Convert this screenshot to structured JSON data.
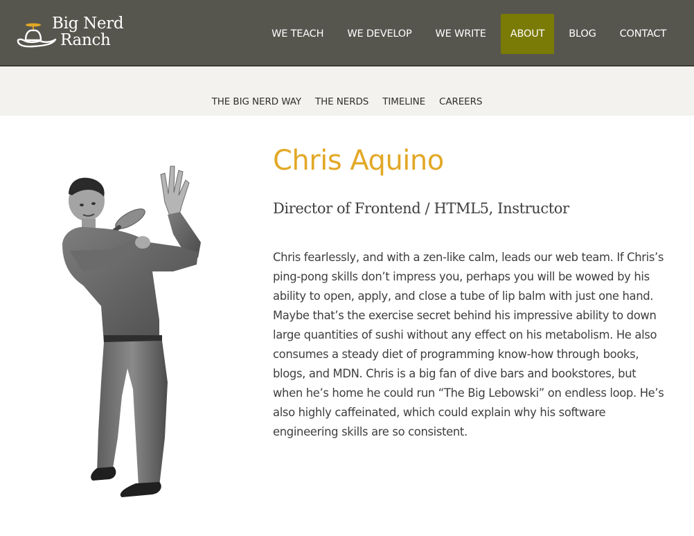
{
  "brand": {
    "line1": "Big Nerd",
    "line2": "Ranch"
  },
  "nav": {
    "items": [
      {
        "label": "WE TEACH"
      },
      {
        "label": "WE DEVELOP"
      },
      {
        "label": "WE WRITE"
      },
      {
        "label": "ABOUT",
        "active": true
      },
      {
        "label": "BLOG"
      },
      {
        "label": "CONTACT"
      }
    ]
  },
  "subnav": {
    "items": [
      {
        "label": "THE BIG NERD WAY"
      },
      {
        "label": "THE NERDS"
      },
      {
        "label": "TIMELINE"
      },
      {
        "label": "CAREERS"
      }
    ]
  },
  "profile": {
    "name": "Chris Aquino",
    "role": "Director of Frontend / HTML5, Instructor",
    "bio": "Chris fearlessly, and with a zen-like calm, leads our web team. If Chris’s ping-pong skills don’t impress you, perhaps you will be wowed by his ability to open, apply, and close a tube of lip balm with just one hand. Maybe that’s the exercise secret behind his impressive ability to down large quantities of sushi without any effect on his metabolism. He also consumes a steady diet of programming know-how through books, blogs, and MDN. Chris is a big fan of dive bars and bookstores, but when he’s home he could run “The Big Lebowski” on endless loop. He’s also highly caffeinated, which could explain why his software engineering skills are so consistent.",
    "photo_icon": "person-photo"
  },
  "colors": {
    "topbar": "#57564e",
    "active_nav": "#7a7a06",
    "subnav_bg": "#f3f2ee",
    "name": "#e2a826",
    "propeller": "#e2a826"
  }
}
